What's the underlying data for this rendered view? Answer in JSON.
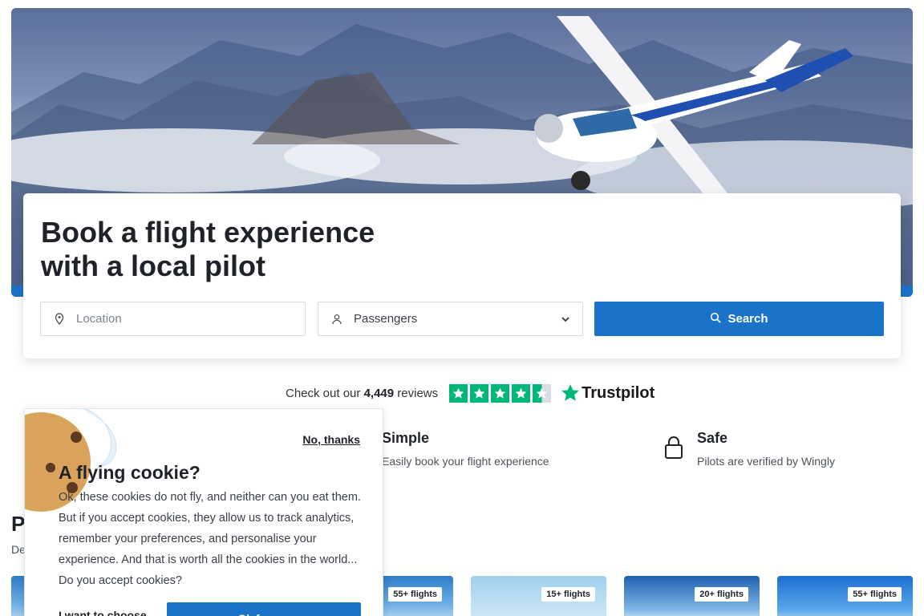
{
  "hero": {
    "headline": "Book a flight experience with a local pilot",
    "image_icon": "plane-over-mountains-image"
  },
  "search": {
    "location_placeholder": "Location",
    "passengers_label": "Passengers",
    "search_label": "Search"
  },
  "trust": {
    "prefix": "Check out our",
    "count": "4,449",
    "suffix": "reviews",
    "rating_stars": 4.5,
    "brand": "Trustpilot"
  },
  "features": [
    {
      "title": "Simple",
      "desc": "Easily book your flight experience",
      "icon": "cursor-icon"
    },
    {
      "title": "Safe",
      "desc": "Pilots are verified by Wingly",
      "icon": "lock-icon"
    }
  ],
  "section": {
    "title_fragment": "P",
    "sub_fragment": "De"
  },
  "tiles": [
    {
      "badge": ""
    },
    {
      "badge": "55+ flights"
    },
    {
      "badge": "15+ flights"
    },
    {
      "badge": "20+ flights"
    },
    {
      "badge": "55+ flights"
    }
  ],
  "cookie": {
    "dismiss_label": "No, thanks",
    "title": "A flying cookie?",
    "body": "Ok, these cookies do not fly, and neither can you eat them. But if you accept cookies, they allow us to track analytics, remember your preferences, and personalise your experience. And that is worth all the cookies in the world... Do you accept cookies?",
    "choose_label": "I want to choose",
    "accept_label": "Ok for me"
  },
  "colors": {
    "primary": "#1a73c8",
    "trustpilot_green": "#00b67a"
  }
}
